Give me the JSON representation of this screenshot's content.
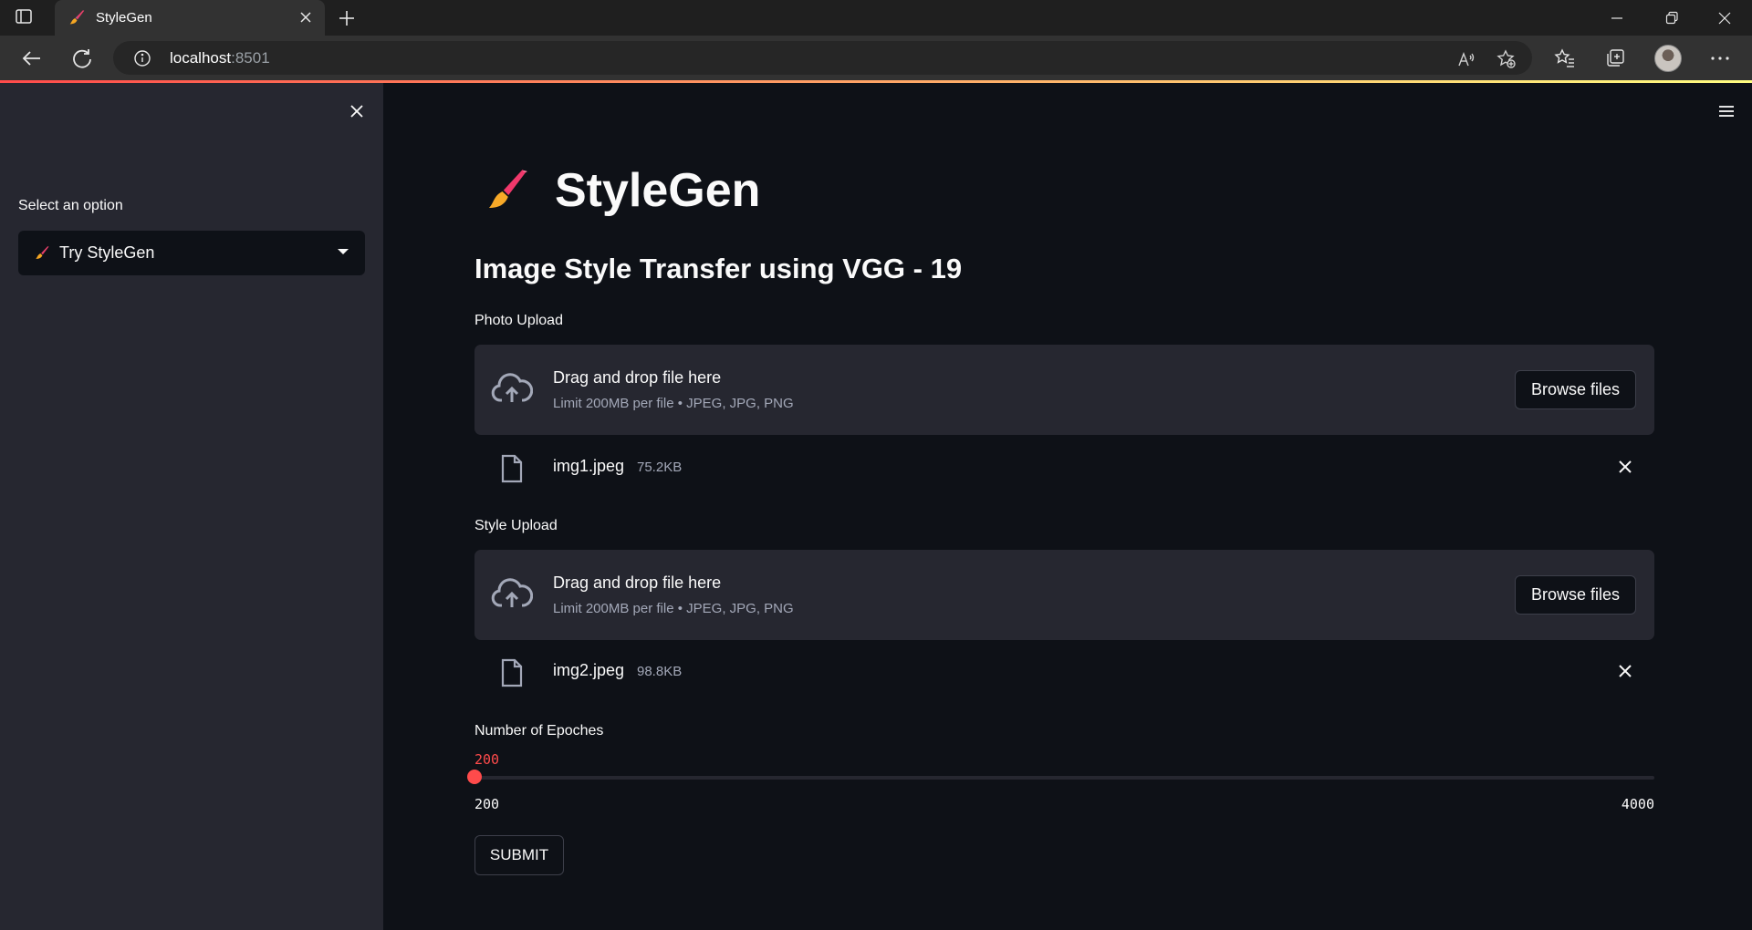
{
  "browser": {
    "tab_title": "StyleGen",
    "url_host": "localhost",
    "url_port": ":8501",
    "favicon": "paintbrush-icon"
  },
  "sidebar": {
    "select_label": "Select an option",
    "selected_option": "Try StyleGen",
    "selected_icon": "paintbrush-icon"
  },
  "main": {
    "title": "StyleGen",
    "title_icon": "paintbrush-icon",
    "subtitle": "Image Style Transfer using VGG - 19",
    "photo_upload": {
      "label": "Photo Upload",
      "drop_title": "Drag and drop file here",
      "drop_sub": "Limit 200MB per file • JPEG, JPG, PNG",
      "browse_label": "Browse files",
      "file_name": "img1.jpeg",
      "file_size": "75.2KB"
    },
    "style_upload": {
      "label": "Style Upload",
      "drop_title": "Drag and drop file here",
      "drop_sub": "Limit 200MB per file • JPEG, JPG, PNG",
      "browse_label": "Browse files",
      "file_name": "img2.jpeg",
      "file_size": "98.8KB"
    },
    "epochs": {
      "label": "Number of Epoches",
      "value": "200",
      "min": "200",
      "max": "4000"
    },
    "submit_label": "SUBMIT"
  },
  "colors": {
    "accent": "#ff4b4b",
    "background": "#0e1117",
    "secondary_background": "#262730",
    "text": "#fafafa"
  }
}
